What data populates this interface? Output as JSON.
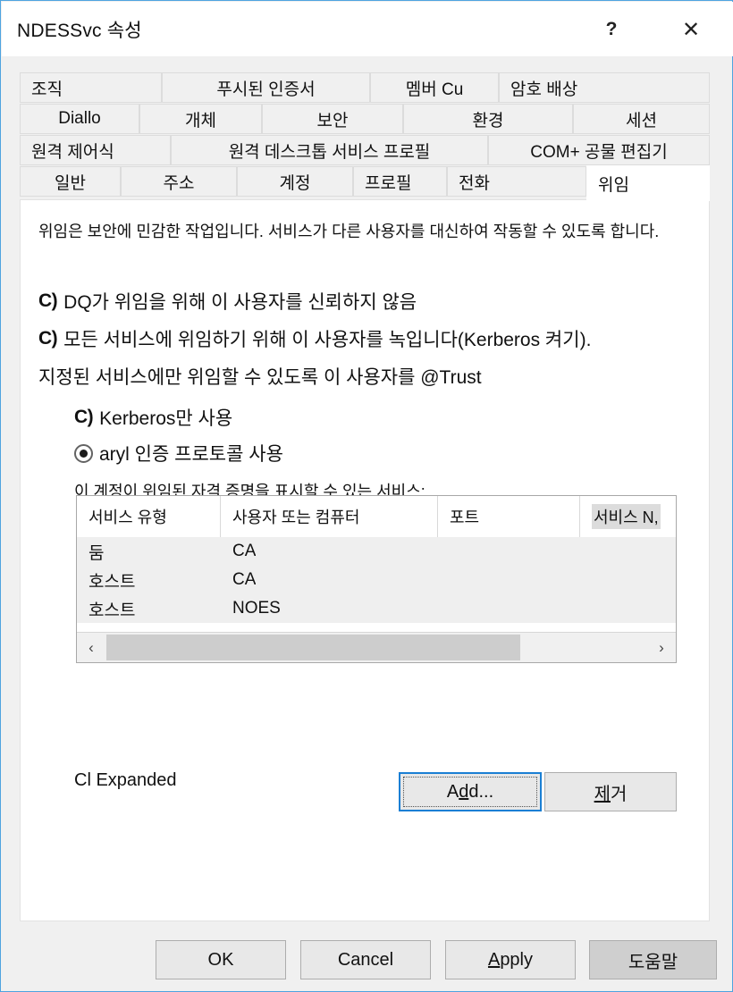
{
  "window": {
    "title": "NDESSvc 속성",
    "help_icon": "?",
    "close_icon": "✕"
  },
  "tabs": {
    "rows": [
      [
        {
          "label": "조직",
          "align": "left"
        },
        {
          "label": "푸시된 인증서",
          "align": "center"
        },
        {
          "label": "멤버 Cu",
          "align": "center"
        },
        {
          "label": "암호 배상",
          "align": "left"
        }
      ],
      [
        {
          "label": "Diallo",
          "align": "center"
        },
        {
          "label": "개체",
          "align": "center"
        },
        {
          "label": "보안",
          "align": "center"
        },
        {
          "label": "환경",
          "align": "center"
        },
        {
          "label": "세션",
          "align": "center"
        }
      ],
      [
        {
          "label": "원격 제어식",
          "align": "left"
        },
        {
          "label": "원격 데스크톱 서비스 프로필",
          "align": "center"
        },
        {
          "label": "COM+ 공물 편집기",
          "align": "center"
        }
      ],
      [
        {
          "label": "일반",
          "align": "center"
        },
        {
          "label": "주소",
          "align": "center"
        },
        {
          "label": "계정",
          "align": "center"
        },
        {
          "label": "프로필",
          "align": "left"
        },
        {
          "label": "전화",
          "align": "left"
        },
        {
          "label": "위임",
          "align": "left",
          "active": true
        }
      ]
    ]
  },
  "content": {
    "description": "위임은 보안에 민감한 작업입니다. 서비스가 다른 사용자를 대신하여 작동할 수 있도록 합니다.",
    "options": [
      {
        "marker": "C)",
        "label": "DQ가 위임을 위해 이 사용자를 신뢰하지 않음",
        "selected": false
      },
      {
        "marker": "C)",
        "label": "모든 서비스에 위임하기 위해 이 사용자를 녹입니다(Kerberos 켜기).",
        "selected": false
      },
      {
        "marker": "",
        "label": "지정된 서비스에만 위임할 수 있도록 이 사용자를 @Trust",
        "selected": false
      },
      {
        "marker": "C)",
        "label": "Kerberos만 사용",
        "selected": false
      },
      {
        "marker": "",
        "label": "aryl 인증 프로토콜 사용",
        "selected": true
      }
    ],
    "list_label": "이 계정이 위임된 자격 증명을 표시할 수 있는 서비스:",
    "listview": {
      "columns": [
        "서비스 유형",
        "사용자 또는 컴퓨터",
        "포트",
        "서비스 N,"
      ],
      "selected_column_index": 3,
      "rows": [
        {
          "service_type": "둠",
          "user_or_computer": "CA"
        },
        {
          "service_type": "호스트",
          "user_or_computer": "CA"
        },
        {
          "service_type": "호스트",
          "user_or_computer": "NOES"
        }
      ],
      "scrollbar": {
        "left_arrow": "‹",
        "right_arrow": "›"
      }
    },
    "expanded_label": "Cl Expanded",
    "add_button": {
      "prefix": "A",
      "accel": "d",
      "suffix": "d..."
    },
    "remove_button": {
      "accel": "제",
      "suffix": "거"
    }
  },
  "footer": {
    "ok": "OK",
    "cancel": "Cancel",
    "apply_prefix": "A",
    "apply_suffix": "pply",
    "help": "도움말"
  },
  "colors": {
    "window_border": "#4ea3e0",
    "focus_blue": "#1a7fd4",
    "panel_bg": "#ffffff",
    "dialog_bg": "#f0f0f0",
    "list_body_bg": "#efefef",
    "scroll_thumb": "#cdcdcd",
    "help_button_bg": "#cfcfcf"
  }
}
